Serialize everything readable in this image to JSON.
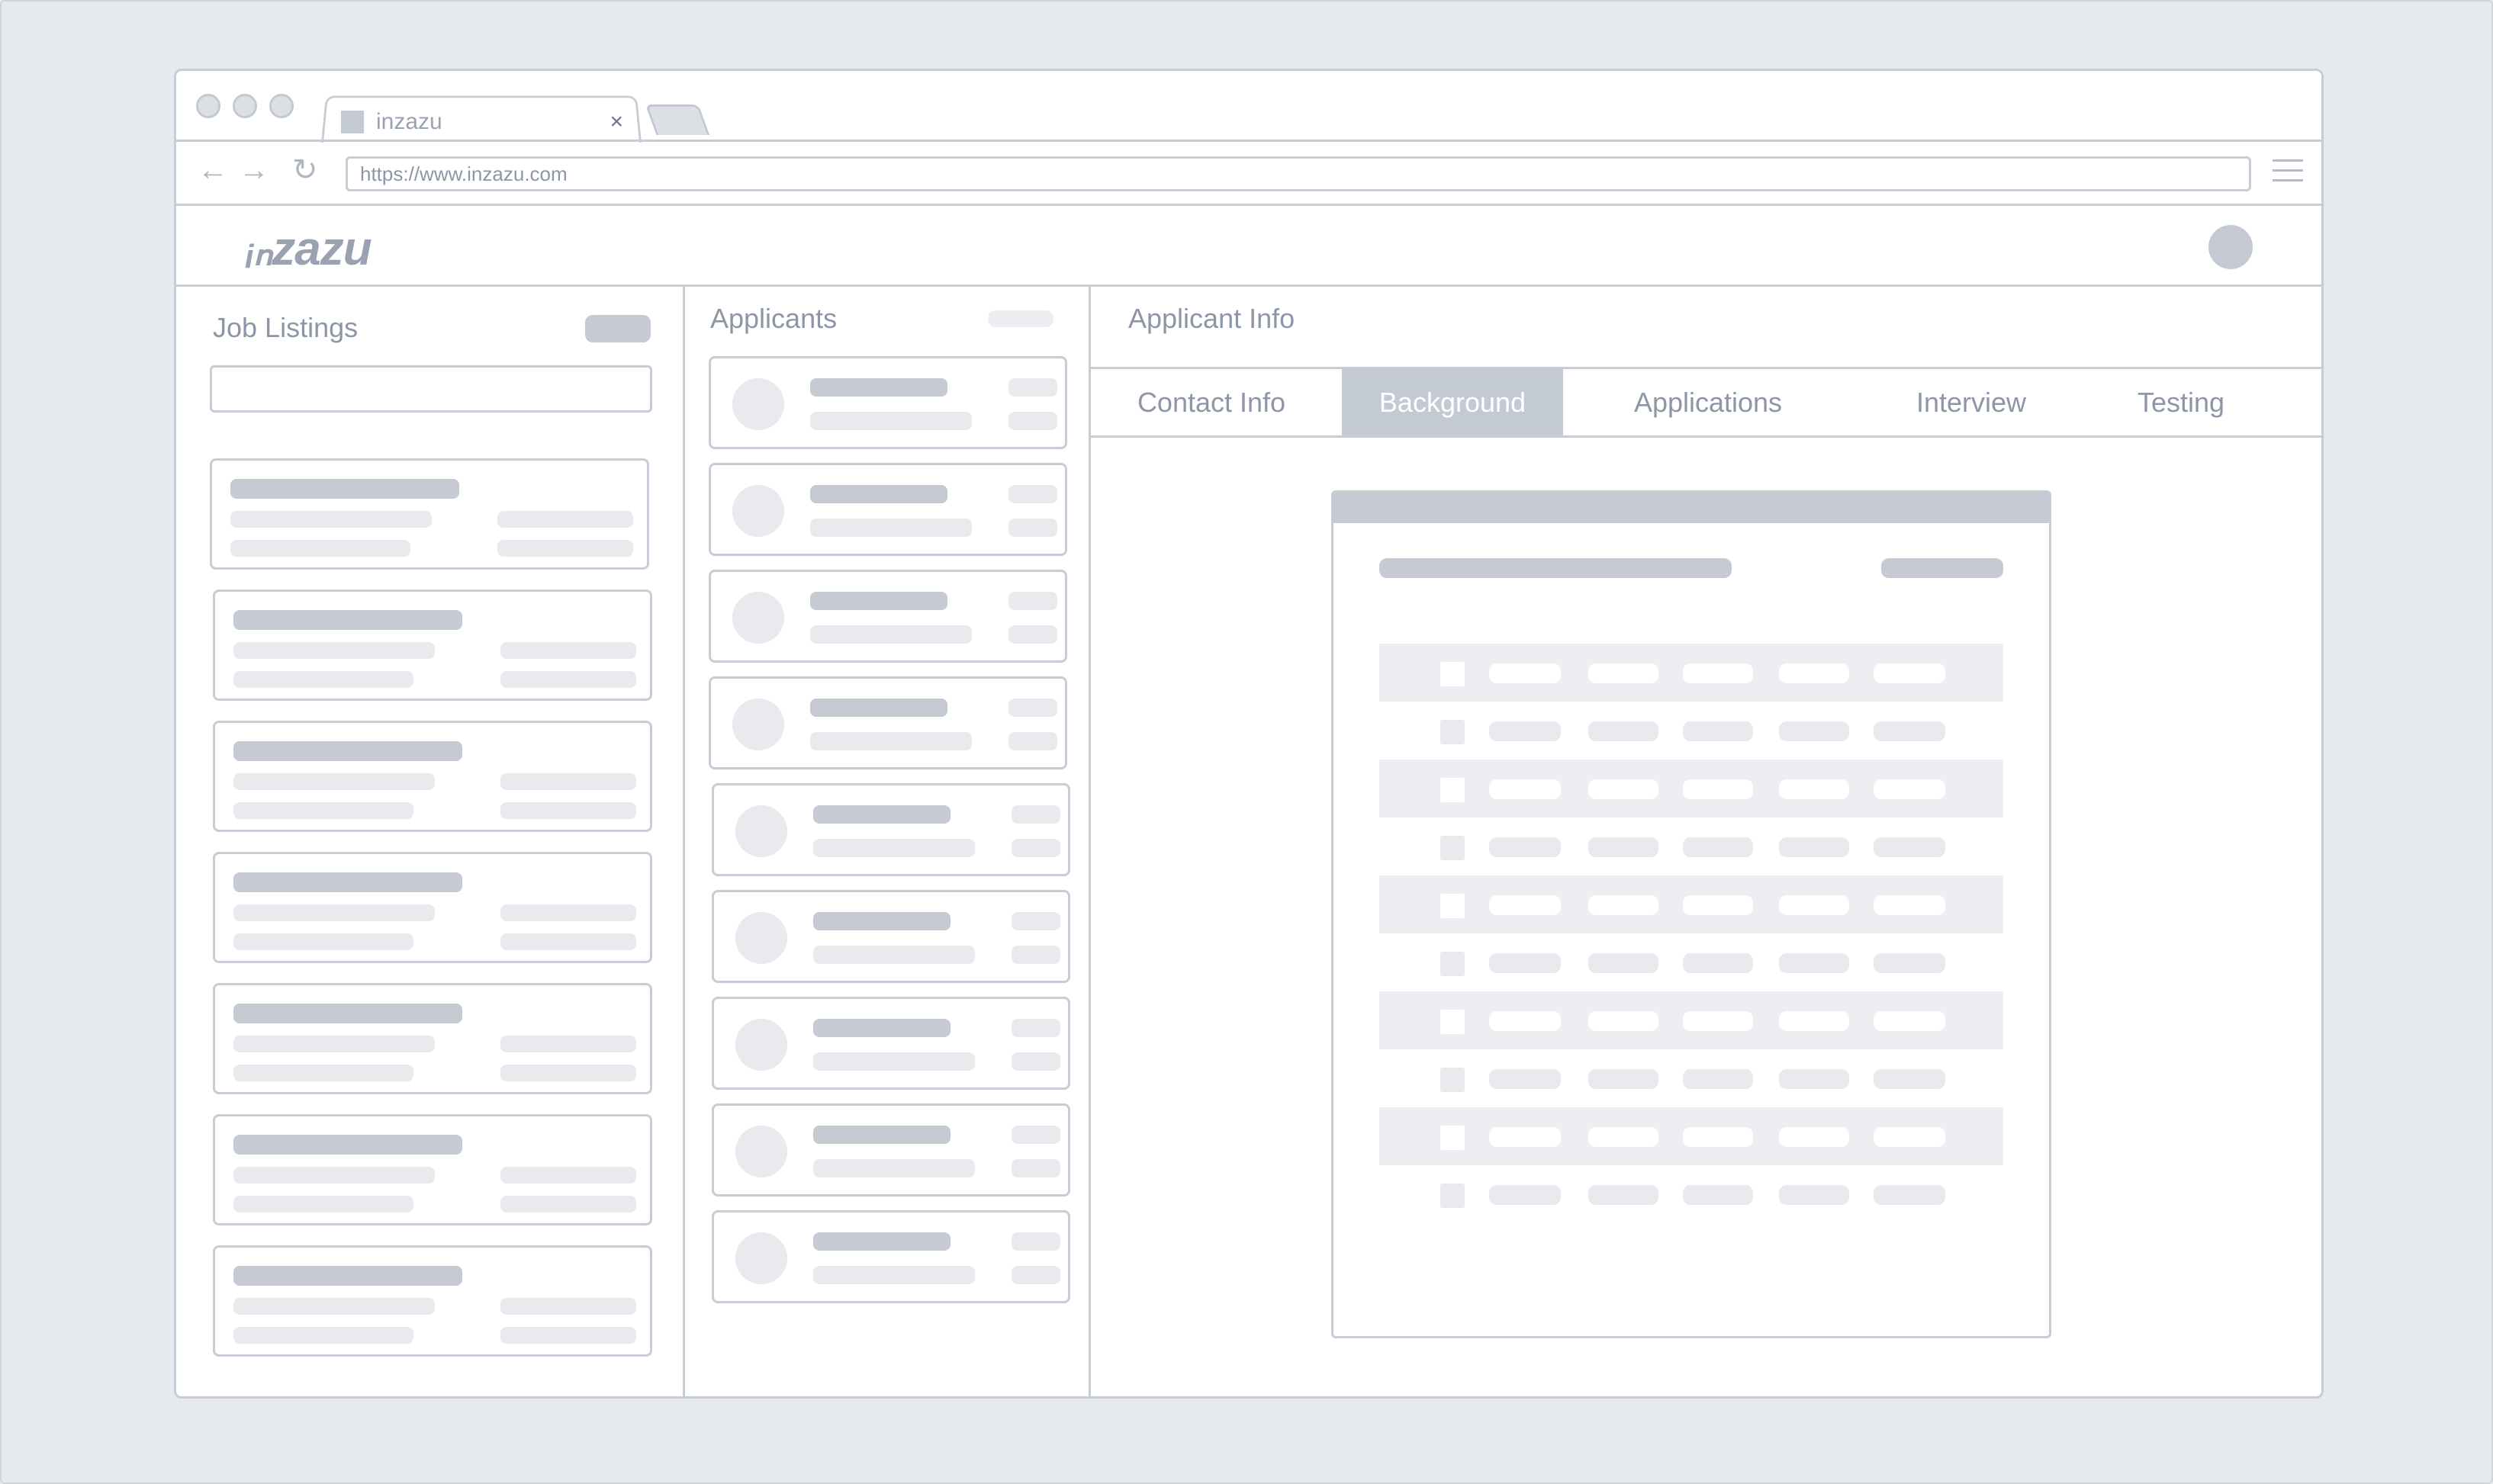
{
  "browser": {
    "tab_title": "inzazu",
    "tab_close": "×",
    "url": "https://www.inzazu.com",
    "back_icon": "←",
    "forward_icon": "→",
    "reload_icon": "↻"
  },
  "app": {
    "logo": "ᵢₙzazu"
  },
  "job_listings": {
    "title": "Job Listings",
    "card_count": 7
  },
  "applicants": {
    "title": "Applicants",
    "card_count": 9
  },
  "applicant_info": {
    "title": "Applicant Info",
    "tabs": [
      {
        "label": "Contact Info",
        "active": false
      },
      {
        "label": "Background",
        "active": true
      },
      {
        "label": "Applications",
        "active": false
      },
      {
        "label": "Interview",
        "active": false
      },
      {
        "label": "Testing",
        "active": false
      }
    ]
  },
  "colors": {
    "accent": "#c4cad3",
    "border": "#c7cdd7",
    "text": "#8d96a7",
    "page_bg": "#e6eaed"
  },
  "icons": [
    "favicon-icon",
    "close-icon",
    "back-arrow-icon",
    "forward-arrow-icon",
    "reload-icon",
    "hamburger-menu-icon",
    "avatar"
  ]
}
